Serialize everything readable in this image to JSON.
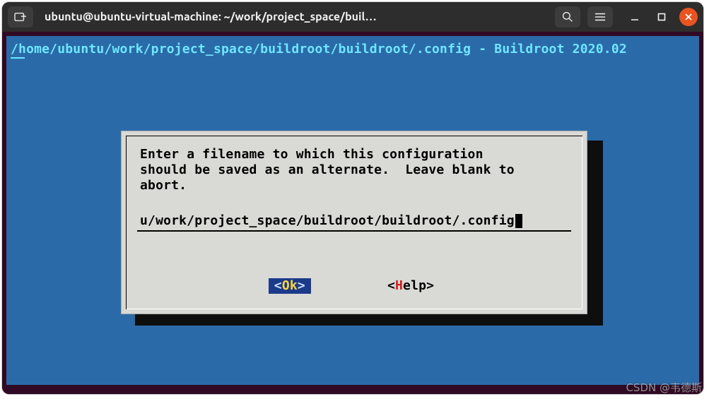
{
  "window": {
    "title": "ubuntu@ubuntu-virtual-machine: ~/work/project_space/buil…"
  },
  "terminal": {
    "path_line": "/home/ubuntu/work/project_space/buildroot/buildroot/.config - Buildroot 2020.02"
  },
  "dialog": {
    "prompt": "Enter a filename to which this configuration\nshould be saved as an alternate.  Leave blank to\nabort.",
    "input_value": "u/work/project_space/buildroot/buildroot/.config",
    "ok_label": "Ok",
    "help_label": "Help",
    "ok_bracket_left": "<  ",
    "ok_bracket_right": "  >",
    "help_bracket_left": "< ",
    "help_bracket_right": " >"
  },
  "icons": {
    "new_tab": "new-tab-icon",
    "search": "search-icon",
    "menu": "menu-icon"
  },
  "watermark": "CSDN @韦德斯"
}
